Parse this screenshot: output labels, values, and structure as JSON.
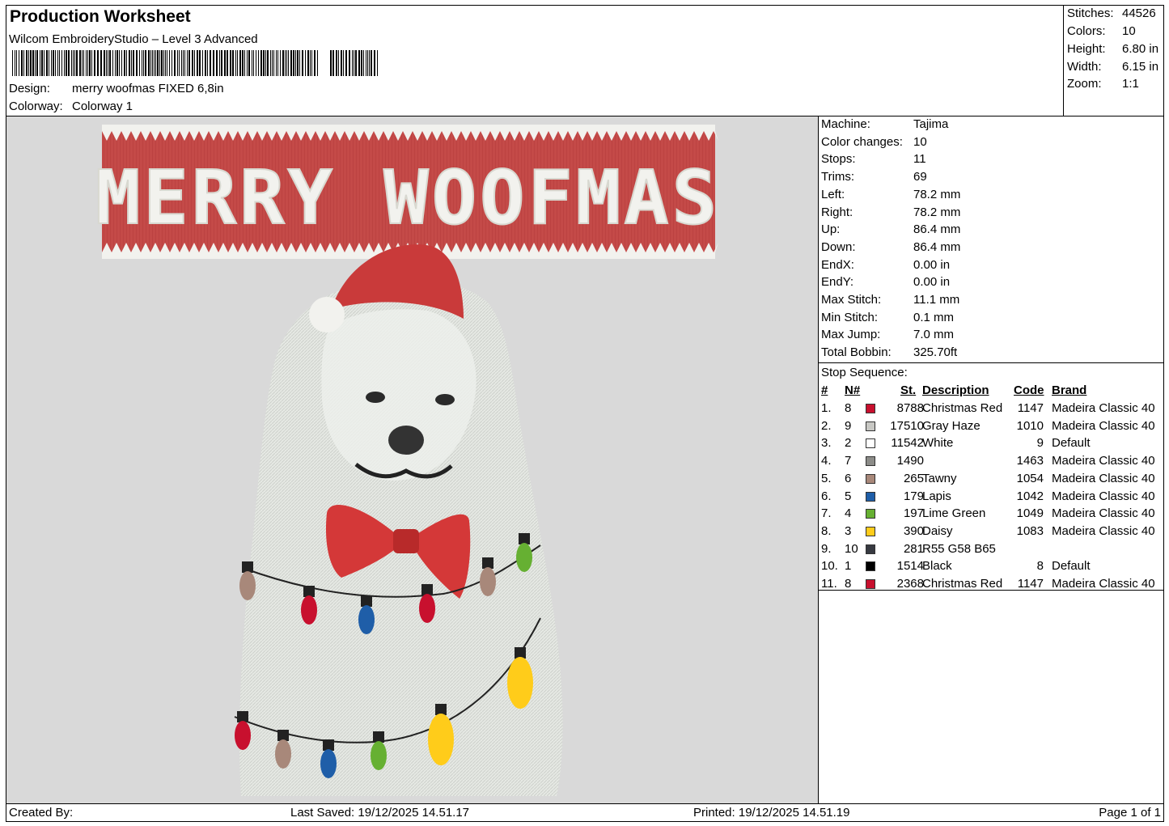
{
  "header": {
    "title": "Production Worksheet",
    "software": "Wilcom EmbroideryStudio – Level 3 Advanced",
    "design_label": "Design:",
    "design_value": "merry woofmas FIXED 6,8in",
    "colorway_label": "Colorway:",
    "colorway_value": "Colorway 1"
  },
  "stats": [
    {
      "label": "Stitches:",
      "value": "44526"
    },
    {
      "label": "Colors:",
      "value": "10"
    },
    {
      "label": "Height:",
      "value": "6.80 in"
    },
    {
      "label": "Width:",
      "value": "6.15 in"
    },
    {
      "label": "Zoom:",
      "value": "1:1"
    }
  ],
  "artwork": {
    "banner_text": "MERRY WOOFMAS",
    "colors": {
      "banner": "#c44a48",
      "stitch_white": "#f2f2ee",
      "fur": "#e8ebe6",
      "fur_shadow": "#cfd3cd",
      "bow": "#d43838",
      "hat": "#c93a3a",
      "canvas": "#d9d9d9"
    }
  },
  "machine_info": [
    {
      "label": "Machine:",
      "value": "Tajima"
    },
    {
      "label": "Color changes:",
      "value": "10"
    },
    {
      "label": "Stops:",
      "value": "11"
    },
    {
      "label": "Trims:",
      "value": "69"
    },
    {
      "label": "Left:",
      "value": "78.2 mm"
    },
    {
      "label": "Right:",
      "value": "78.2 mm"
    },
    {
      "label": "Up:",
      "value": "86.4 mm"
    },
    {
      "label": "Down:",
      "value": "86.4 mm"
    },
    {
      "label": "EndX:",
      "value": "0.00 in"
    },
    {
      "label": "EndY:",
      "value": "0.00 in"
    },
    {
      "label": "Max Stitch:",
      "value": "11.1 mm"
    },
    {
      "label": "Min Stitch:",
      "value": "0.1 mm"
    },
    {
      "label": "Max Jump:",
      "value": "7.0 mm"
    },
    {
      "label": "Total Bobbin:",
      "value": "325.70ft"
    }
  ],
  "stop_sequence": {
    "title": "Stop Sequence:",
    "headers": {
      "num": "#",
      "n": "N#",
      "st": "St.",
      "desc": "Description",
      "code": "Code",
      "brand": "Brand"
    },
    "rows": [
      {
        "num": "1.",
        "n": "8",
        "color": "#c8102e",
        "st": "8788",
        "desc": "Christmas Red",
        "code": "1147",
        "brand": "Madeira Classic 40"
      },
      {
        "num": "2.",
        "n": "9",
        "color": "#c8c8c4",
        "st": "17510",
        "desc": "Gray Haze",
        "code": "1010",
        "brand": "Madeira Classic 40"
      },
      {
        "num": "3.",
        "n": "2",
        "color": "#ffffff",
        "st": "11542",
        "desc": "White",
        "code": "9",
        "brand": "Default"
      },
      {
        "num": "4.",
        "n": "7",
        "color": "#8c8c88",
        "st": "1490",
        "desc": "",
        "code": "1463",
        "brand": "Madeira Classic 40"
      },
      {
        "num": "5.",
        "n": "6",
        "color": "#a8887a",
        "st": "265",
        "desc": "Tawny",
        "code": "1054",
        "brand": "Madeira Classic 40"
      },
      {
        "num": "6.",
        "n": "5",
        "color": "#1f5ea8",
        "st": "179",
        "desc": "Lapis",
        "code": "1042",
        "brand": "Madeira Classic 40"
      },
      {
        "num": "7.",
        "n": "4",
        "color": "#66b032",
        "st": "197",
        "desc": "Lime Green",
        "code": "1049",
        "brand": "Madeira Classic 40"
      },
      {
        "num": "8.",
        "n": "3",
        "color": "#ffcc1a",
        "st": "390",
        "desc": "Daisy",
        "code": "1083",
        "brand": "Madeira Classic 40"
      },
      {
        "num": "9.",
        "n": "10",
        "color": "#373a41",
        "st": "281",
        "desc": "R55 G58 B65",
        "code": "",
        "brand": ""
      },
      {
        "num": "10.",
        "n": "1",
        "color": "#000000",
        "st": "1514",
        "desc": "Black",
        "code": "8",
        "brand": "Default"
      },
      {
        "num": "11.",
        "n": "8",
        "color": "#c8102e",
        "st": "2368",
        "desc": "Christmas Red",
        "code": "1147",
        "brand": "Madeira Classic 40"
      }
    ]
  },
  "footer": {
    "created_by": "Created By:",
    "last_saved": "Last Saved: 19/12/2025 14.51.17",
    "printed": "Printed: 19/12/2025 14.51.19",
    "page": "Page 1 of 1"
  }
}
